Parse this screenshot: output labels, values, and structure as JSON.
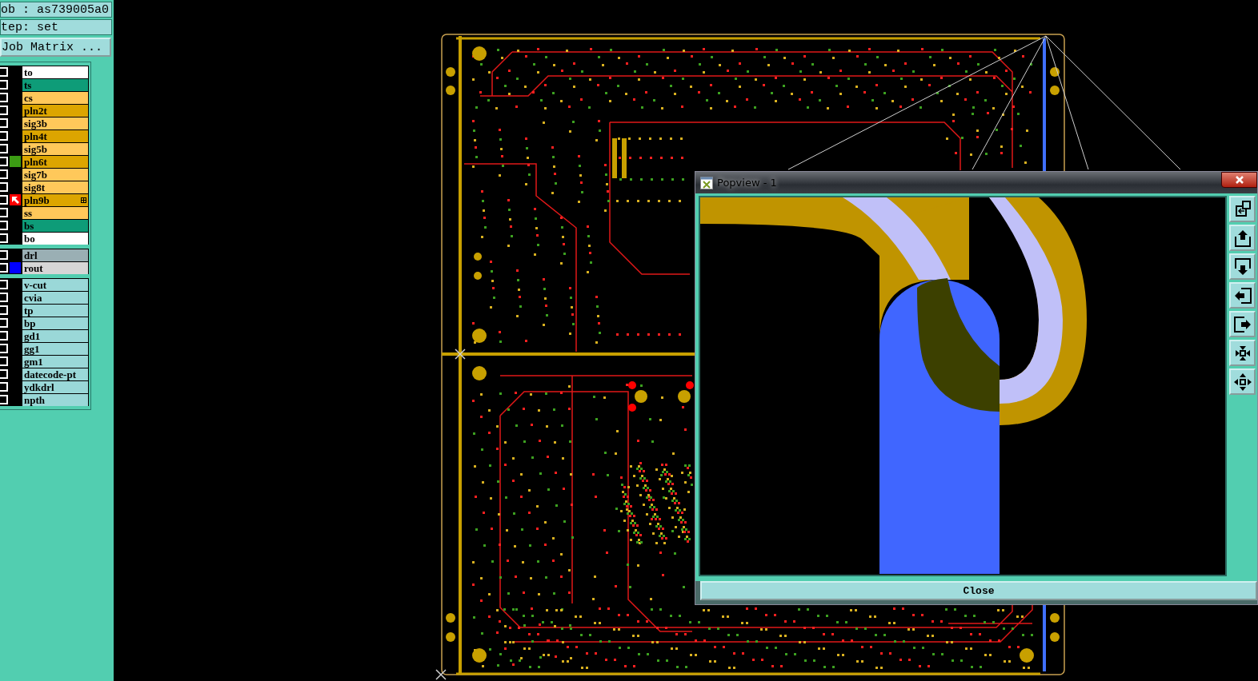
{
  "job_label": "ob : as739005a0",
  "step_label": "tep: set",
  "job_matrix_button": "Job Matrix ...",
  "layer_groups": [
    {
      "layers": [
        {
          "name": "to",
          "color": "#ffffff",
          "affected": false
        },
        {
          "name": "ts",
          "color": "#0e9c78",
          "affected": false
        },
        {
          "name": "cs",
          "color": "#ffc85a",
          "affected": false
        },
        {
          "name": "pln2t",
          "color": "#dca500",
          "affected": false
        },
        {
          "name": "sig3b",
          "color": "#ffc85a",
          "affected": false
        },
        {
          "name": "pln4t",
          "color": "#dca500",
          "affected": false
        },
        {
          "name": "sig5b",
          "color": "#ffc85a",
          "affected": false
        },
        {
          "name": "pln6t",
          "color": "#dca500",
          "affected": false,
          "swatch": {
            "color": "#3c9c14"
          }
        },
        {
          "name": "sig7b",
          "color": "#ffc85a",
          "affected": false
        },
        {
          "name": "sig8t",
          "color": "#ffc85a",
          "affected": false
        },
        {
          "name": "pln9b",
          "color": "#dca500",
          "affected": false,
          "swatch": {
            "color": "#ff0000"
          },
          "work_layer": true
        },
        {
          "name": "ss",
          "color": "#ffc85a",
          "affected": false
        },
        {
          "name": "bs",
          "color": "#0e9c78",
          "affected": false
        },
        {
          "name": "bo",
          "color": "#ffffff",
          "affected": false
        }
      ]
    },
    {
      "layers": [
        {
          "name": "drl",
          "color": "#9aafb4",
          "affected": false
        },
        {
          "name": "rout",
          "color": "#d6d6d6",
          "affected": false,
          "swatch": {
            "color": "#0000ff"
          }
        }
      ]
    },
    {
      "layers": [
        {
          "name": "v-cut",
          "color": "#9ad8d8",
          "affected": false
        },
        {
          "name": "cvia",
          "color": "#9ad8d8",
          "affected": false
        },
        {
          "name": "tp",
          "color": "#9ad8d8",
          "affected": false
        },
        {
          "name": "bp",
          "color": "#9ad8d8",
          "affected": false
        },
        {
          "name": "gd1",
          "color": "#9ad8d8",
          "affected": false
        },
        {
          "name": "gg1",
          "color": "#9ad8d8",
          "affected": false
        },
        {
          "name": "gm1",
          "color": "#9ad8d8",
          "affected": false
        },
        {
          "name": "datecode-pt",
          "color": "#9ad8d8",
          "affected": false
        },
        {
          "name": "ydkdrl",
          "color": "#9ad8d8",
          "affected": false
        },
        {
          "name": "npth",
          "color": "#9ad8d8",
          "affected": false
        }
      ]
    }
  ],
  "popview": {
    "title": "Popview - 1",
    "close_button": "Close"
  }
}
